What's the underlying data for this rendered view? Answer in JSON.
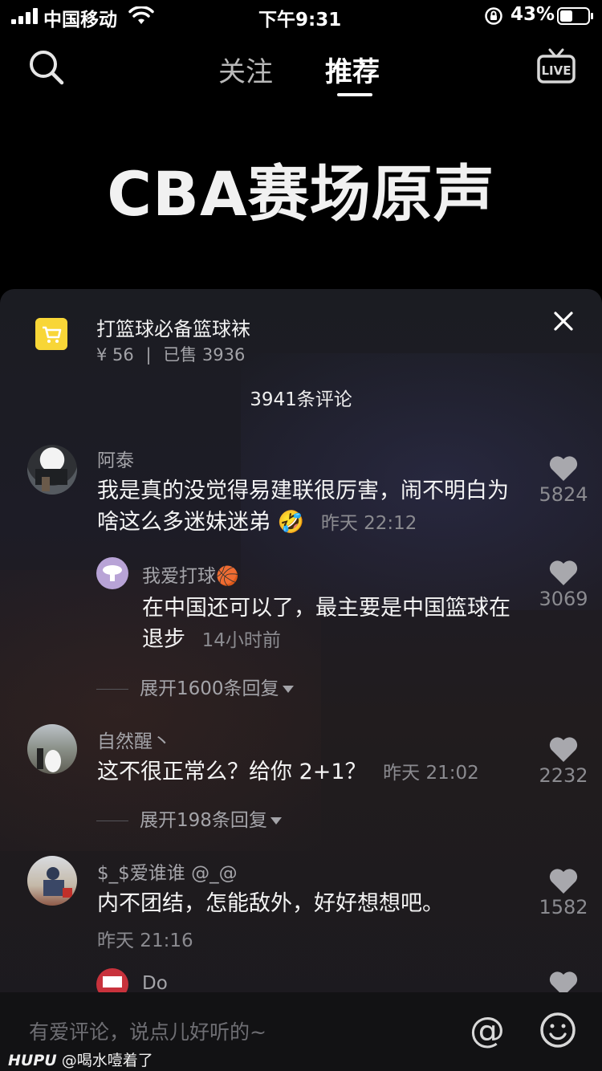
{
  "status_bar": {
    "carrier": "中国移动",
    "time": "下午9:31",
    "battery": "43%",
    "icons": [
      "signal-icon",
      "wifi-icon",
      "rotation-lock-icon",
      "battery-icon"
    ]
  },
  "top_nav": {
    "tabs": [
      {
        "label": "关注",
        "active": false
      },
      {
        "label": "推荐",
        "active": true
      }
    ],
    "live_label": "LIVE"
  },
  "video": {
    "title": "CBA赛场原声"
  },
  "product": {
    "name": "打篮球必备篮球袜",
    "price": "¥ 56",
    "separator": "|",
    "sold": "已售 3936"
  },
  "comments_header": {
    "count": "3941条评论"
  },
  "comments": [
    {
      "user": "阿泰",
      "text": "我是真的没觉得易建联很厉害，闹不明白为啥这么多迷妹迷弟",
      "emoji": "🤣",
      "time": "昨天 22:12",
      "likes": "5824"
    },
    {
      "user": "我爱打球🏀",
      "text": "在中国还可以了，最主要是中国篮球在退步",
      "time": "14小时前",
      "likes": "3069"
    },
    {
      "user": "自然醒丶",
      "text": "这不很正常么？给你 2+1？",
      "time": "昨天 21:02",
      "likes": "2232"
    },
    {
      "user": "$_$爱谁谁 @_@",
      "text": "内不团结，怎能敌外，好好想想吧。",
      "time": "昨天 21:16",
      "likes": "1582"
    },
    {
      "user": "Do",
      "text": "",
      "time": "",
      "likes": ""
    }
  ],
  "expand_replies": [
    {
      "label": "展开1600条回复"
    },
    {
      "label": "展开198条回复"
    }
  ],
  "input_bar": {
    "placeholder": "有爱评论，说点儿好听的~",
    "at_label": "@"
  },
  "watermark": {
    "logo": "HUPU",
    "text": "@喝水噎着了"
  }
}
